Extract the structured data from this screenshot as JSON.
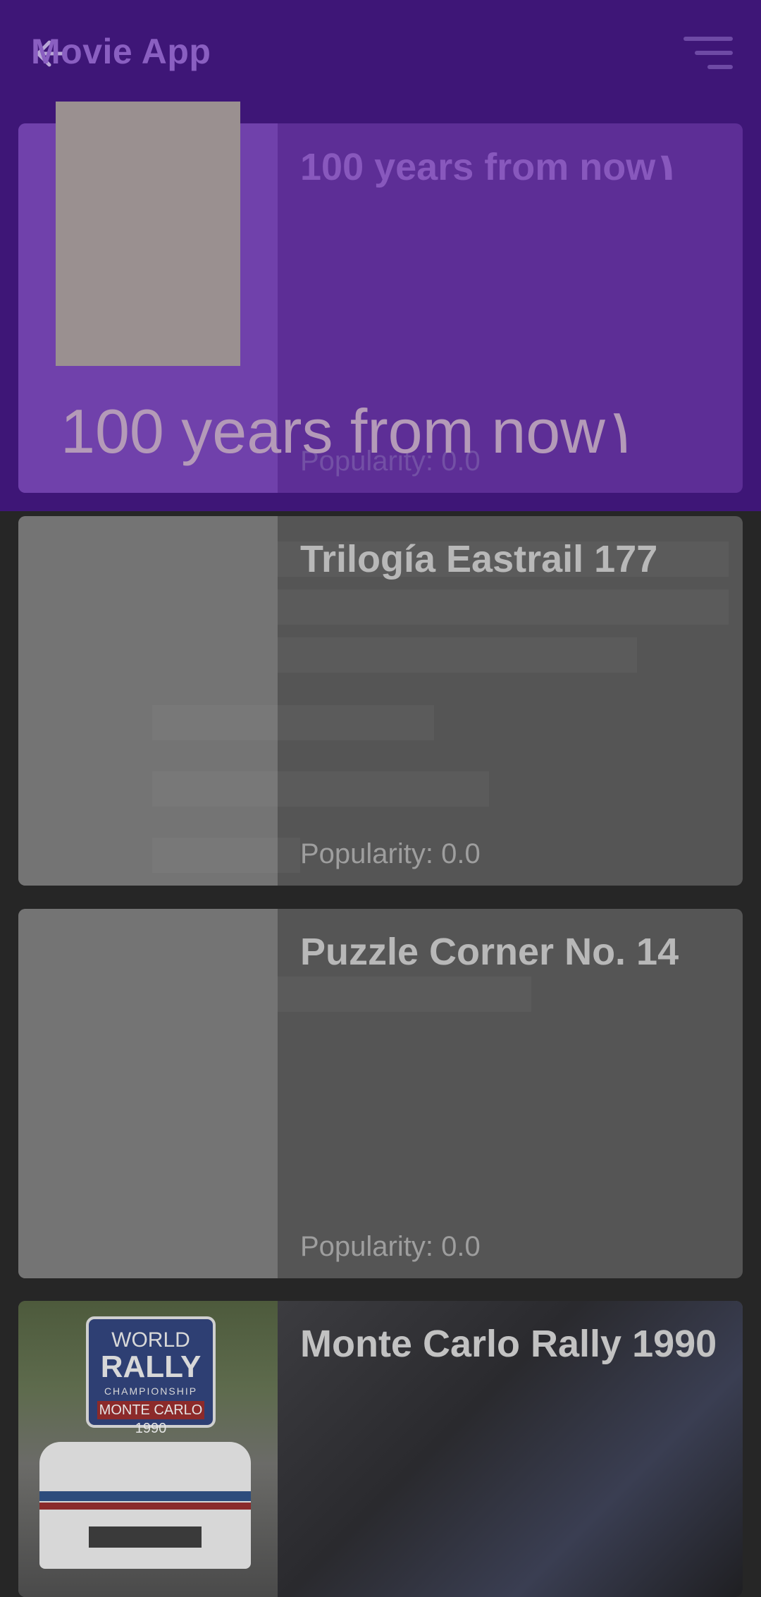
{
  "appbar": {
    "title": "Movie App",
    "back_icon": "arrow-left-icon",
    "sort_icon": "sort-icon",
    "color": "#3e1677"
  },
  "dragging": {
    "label": "100 years from now١"
  },
  "movies": [
    {
      "title": "100 years from now١",
      "popularity": "Popularity: 0.0"
    },
    {
      "title": "Trilogía Eastrail 177",
      "popularity": "Popularity: 0.0"
    },
    {
      "title": "Puzzle Corner No. 14",
      "popularity": "Popularity: 0.0"
    },
    {
      "title": "Monte Carlo Rally 1990",
      "popularity": ""
    }
  ],
  "rally_badge": {
    "line1": "WORLD",
    "line2": "RALLY",
    "line3": "CHAMPIONSHIP",
    "line4": "MONTE CARLO 1990"
  }
}
